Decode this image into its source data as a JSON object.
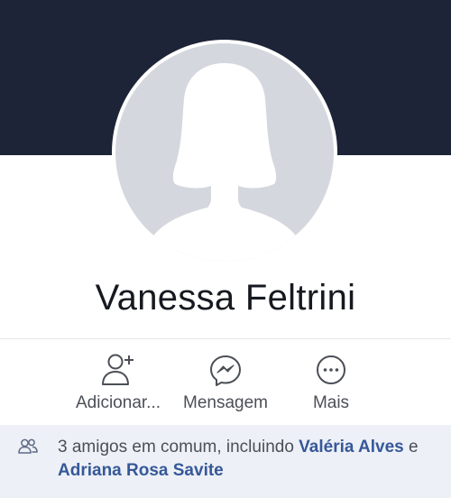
{
  "profile": {
    "name": "Vanessa Feltrini",
    "avatar_icon": "default-female-silhouette"
  },
  "actions": [
    {
      "label": "Adicionar...",
      "icon": "add-friend-icon"
    },
    {
      "label": "Mensagem",
      "icon": "messenger-icon"
    },
    {
      "label": "Mais",
      "icon": "more-icon"
    }
  ],
  "mutual_friends": {
    "icon": "friends-icon",
    "prefix": "3 amigos em comum, incluindo ",
    "friend1": "Valéria Alves",
    "connector": " e ",
    "friend2": "Adriana Rosa Savite"
  },
  "colors": {
    "cover": "#1d2437",
    "avatar_bg": "#d4d8de",
    "link": "#365899",
    "mutual_bg": "#edf0f6"
  }
}
